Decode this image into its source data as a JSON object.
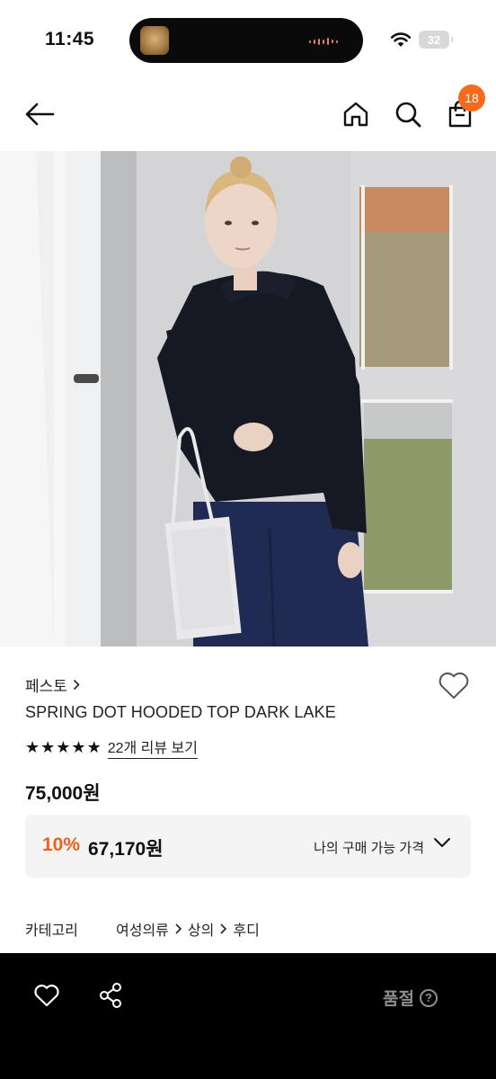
{
  "status_bar": {
    "time": "11:45",
    "battery": "32",
    "icons": [
      "wifi-icon",
      "battery-icon"
    ]
  },
  "nav": {
    "icons": [
      "back-arrow-icon",
      "home-icon",
      "search-icon",
      "shopping-bag-icon"
    ],
    "cart_badge": "18",
    "badge_color": "#f56b1a"
  },
  "product": {
    "brand": "페스토",
    "name": "SPRING DOT HOODED TOP DARK LAKE",
    "rating_stars": 5,
    "review_link": "22개 리뷰 보기",
    "price": "75,000원",
    "discount": {
      "rate": "10%",
      "price": "67,170원",
      "label": "나의 구매 가능 가격",
      "accent": "#f0601c"
    },
    "category": {
      "label": "카테고리",
      "path": [
        "여성의류",
        "상의",
        "후디"
      ]
    }
  },
  "bottom_bar": {
    "icons": [
      "heart-icon",
      "share-icon"
    ],
    "status": "품절",
    "help": "?"
  }
}
